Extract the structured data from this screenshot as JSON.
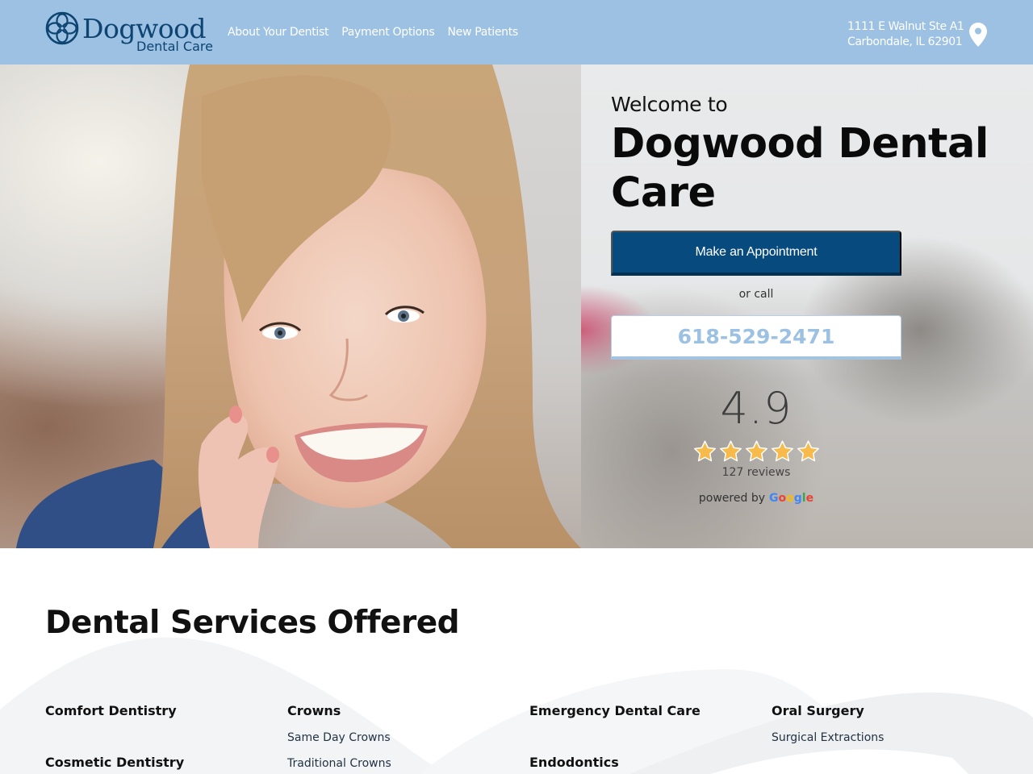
{
  "header": {
    "logo": {
      "word": "Dogwood",
      "sub": "Dental Care",
      "brand_color": "#0d4471"
    },
    "nav": [
      {
        "label": "About Your Dentist"
      },
      {
        "label": "Payment Options"
      },
      {
        "label": "New Patients"
      }
    ],
    "address": {
      "line1": "1111 E Walnut Ste A1",
      "line2": "Carbondale, IL 62901",
      "icon": "map-pin-icon"
    },
    "background": "#9cc1e3"
  },
  "hero": {
    "welcome": "Welcome to",
    "title": "Dogwood Dental Care",
    "appointment_label": "Make an Appointment",
    "or_call": "or call",
    "phone": "618-529-2471",
    "rating": {
      "value": "4.9",
      "stars": 5,
      "reviews": "127 reviews",
      "powered_by": "powered by",
      "provider": "Google"
    },
    "accent": "#074a7e",
    "star_color": "#f6bb4b"
  },
  "services": {
    "title": "Dental Services Offered",
    "columns": [
      {
        "groups": [
          {
            "head": "Comfort Dentistry",
            "items": []
          },
          {
            "head": "Cosmetic Dentistry",
            "items": []
          }
        ]
      },
      {
        "groups": [
          {
            "head": "Crowns",
            "items": [
              "Same Day Crowns",
              "Traditional Crowns"
            ]
          }
        ]
      },
      {
        "groups": [
          {
            "head": "Emergency Dental Care",
            "items": []
          },
          {
            "head": "Endodontics",
            "items": []
          }
        ]
      },
      {
        "groups": [
          {
            "head": "Oral Surgery",
            "items": [
              "Surgical Extractions"
            ]
          }
        ]
      }
    ]
  }
}
